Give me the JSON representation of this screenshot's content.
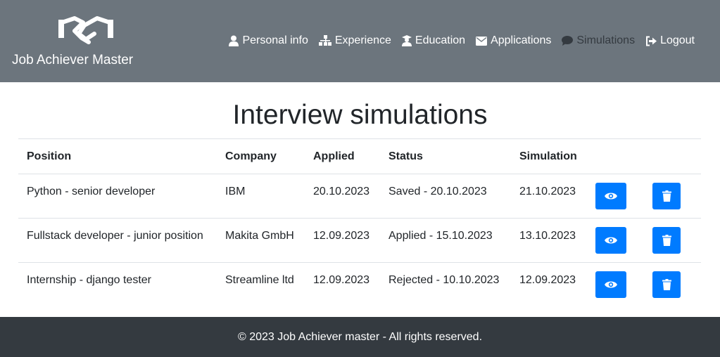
{
  "header": {
    "brand_title": "Job Achiever Master",
    "brand_icon": "handshake-icon",
    "nav": [
      {
        "label": "Personal info",
        "icon": "user-icon"
      },
      {
        "label": "Experience",
        "icon": "sitemap-icon"
      },
      {
        "label": "Education",
        "icon": "graduate-icon"
      },
      {
        "label": "Applications",
        "icon": "envelope-icon"
      },
      {
        "label": "Simulations",
        "icon": "comment-icon",
        "active": true
      },
      {
        "label": "Logout",
        "icon": "sign-out-icon"
      }
    ]
  },
  "main": {
    "title": "Interview simulations",
    "table": {
      "headers": [
        "Position",
        "Company",
        "Applied",
        "Status",
        "Simulation"
      ],
      "rows": [
        {
          "position": "Python - senior developer",
          "company": "IBM",
          "applied": "20.10.2023",
          "status": "Saved - 20.10.2023",
          "simulation": "21.10.2023"
        },
        {
          "position": "Fullstack developer - junior position",
          "company": "Makita GmbH",
          "applied": "12.09.2023",
          "status": "Applied - 15.10.2023",
          "simulation": "13.10.2023"
        },
        {
          "position": "Internship - django tester",
          "company": "Streamline ltd",
          "applied": "12.09.2023",
          "status": "Rejected - 10.10.2023",
          "simulation": "12.09.2023"
        }
      ]
    }
  },
  "footer": {
    "text": "© 2023 Job Achiever master - All rights reserved."
  },
  "colors": {
    "header_bg": "#6c757d",
    "footer_bg": "#343a40",
    "button_primary": "#007bff",
    "nav_active": "#343a40"
  }
}
